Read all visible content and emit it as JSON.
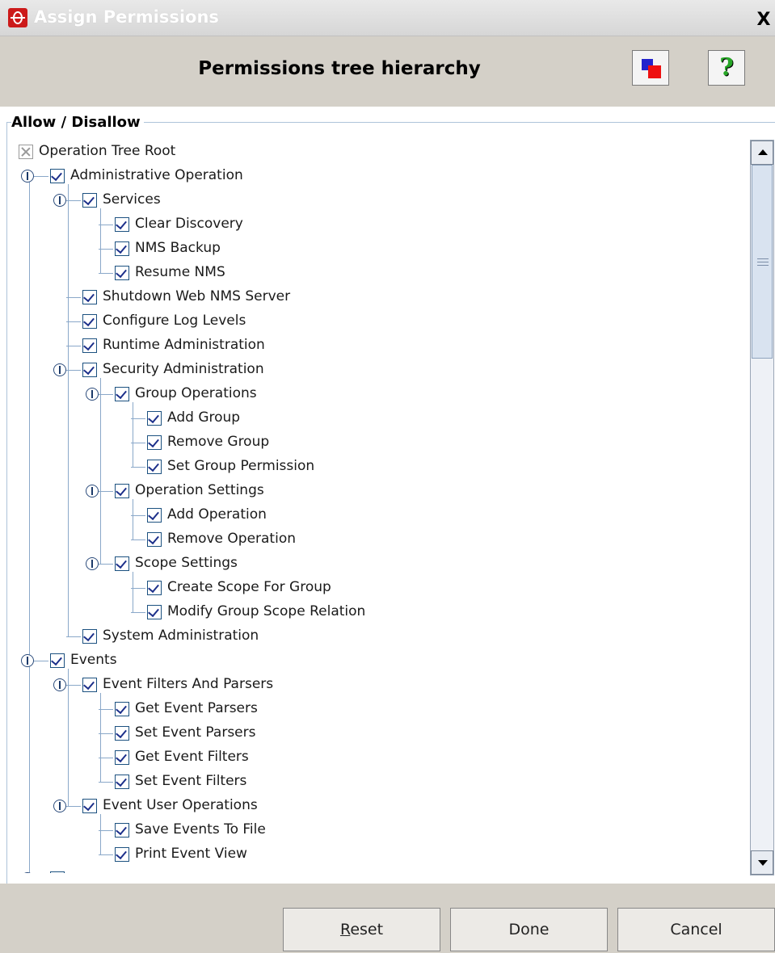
{
  "window": {
    "title": "Assign Permissions",
    "close_glyph": "X"
  },
  "header": {
    "title": "Permissions tree hierarchy",
    "help_glyph": "?",
    "color_button_icon": "color-swatch-icon",
    "help_button_icon": "help-icon"
  },
  "panel": {
    "legend": "Allow / Disallow"
  },
  "tree": {
    "items": [
      {
        "label": "Operation Tree Root",
        "checked": "mixed"
      },
      {
        "label": "Administrative Operation",
        "checked": true,
        "expanded": true
      },
      {
        "label": "Services",
        "checked": true,
        "expanded": true
      },
      {
        "label": "Clear Discovery",
        "checked": true
      },
      {
        "label": "NMS Backup",
        "checked": true
      },
      {
        "label": "Resume NMS",
        "checked": true
      },
      {
        "label": "Shutdown Web NMS Server",
        "checked": true
      },
      {
        "label": "Configure Log Levels",
        "checked": true
      },
      {
        "label": "Runtime Administration",
        "checked": true
      },
      {
        "label": "Security Administration",
        "checked": true,
        "expanded": true
      },
      {
        "label": "Group Operations",
        "checked": true,
        "expanded": true
      },
      {
        "label": "Add Group",
        "checked": true
      },
      {
        "label": "Remove Group",
        "checked": true
      },
      {
        "label": "Set Group Permission",
        "checked": true
      },
      {
        "label": "Operation Settings",
        "checked": true,
        "expanded": true
      },
      {
        "label": "Add Operation",
        "checked": true
      },
      {
        "label": "Remove Operation",
        "checked": true
      },
      {
        "label": "Scope Settings",
        "checked": true,
        "expanded": true
      },
      {
        "label": "Create Scope For Group",
        "checked": true
      },
      {
        "label": "Modify Group Scope Relation",
        "checked": true
      },
      {
        "label": "System Administration",
        "checked": true
      },
      {
        "label": "Events",
        "checked": true,
        "expanded": true
      },
      {
        "label": "Event Filters And Parsers",
        "checked": true,
        "expanded": true
      },
      {
        "label": "Get Event Parsers",
        "checked": true
      },
      {
        "label": "Set Event Parsers",
        "checked": true
      },
      {
        "label": "Get Event Filters",
        "checked": true
      },
      {
        "label": "Set Event Filters",
        "checked": true
      },
      {
        "label": "Event User Operations",
        "checked": true,
        "expanded": true
      },
      {
        "label": "Save Events To File",
        "checked": true
      },
      {
        "label": "Print Event View",
        "checked": true
      },
      {
        "label": "",
        "checked": true,
        "expanded": true
      }
    ]
  },
  "footer": {
    "reset_mnemonic": "R",
    "reset_rest": "eset",
    "done_label": "Done",
    "cancel_label": "Cancel"
  },
  "colors": {
    "tree_line": "#8aa8c9",
    "checkbox_border": "#1c5180",
    "groupbox_border": "#aec3d9",
    "dialog_bg": "#d4d0c8"
  }
}
